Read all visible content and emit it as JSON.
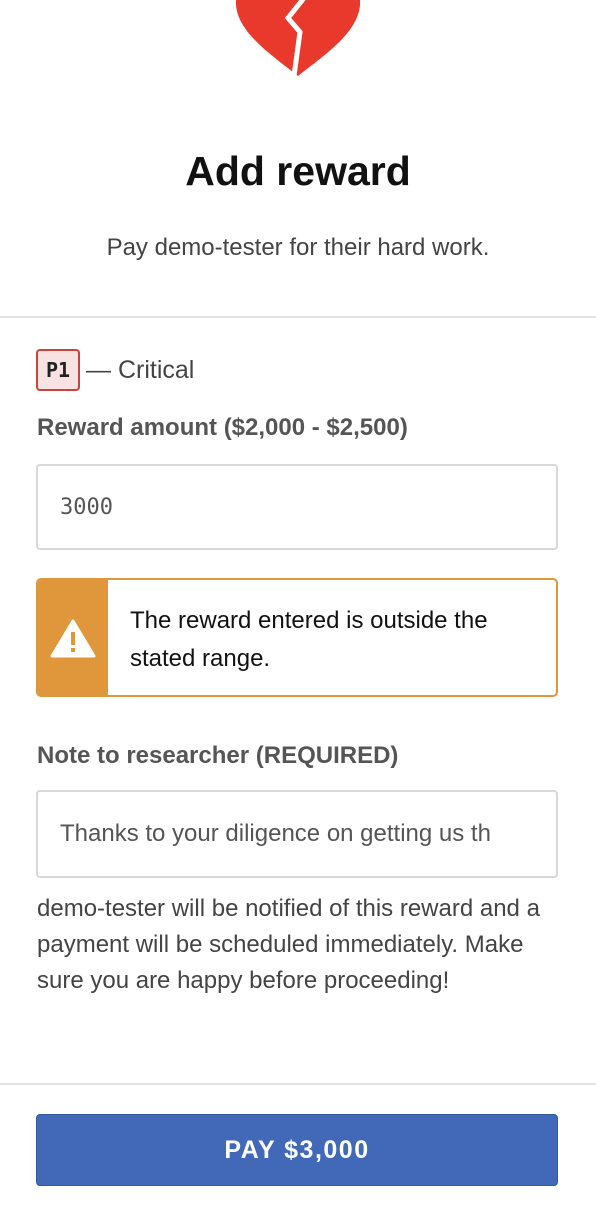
{
  "header": {
    "title": "Add reward",
    "subtitle": "Pay demo-tester for their hard work.",
    "icon": "broken-heart-icon",
    "icon_color": "#e8392c"
  },
  "severity": {
    "badge": "P1",
    "label": "— Critical",
    "badge_border_color": "#c8443c",
    "badge_background": "#f9e3e2"
  },
  "reward": {
    "label": "Reward amount ($2,000 - $2,500)",
    "value": "3000"
  },
  "warning": {
    "icon": "warning-triangle-icon",
    "message": "The reward entered is outside the stated range.",
    "color": "#e0963a"
  },
  "note": {
    "label": "Note to researcher (REQUIRED)",
    "value": "Thanks to your diligence on getting us th"
  },
  "help_text": "demo-tester will be notified of this reward and a payment will be scheduled immediately. Make sure you are happy before proceeding!",
  "actions": {
    "pay_label": "PAY $3,000",
    "pay_color": "#4268b8"
  }
}
